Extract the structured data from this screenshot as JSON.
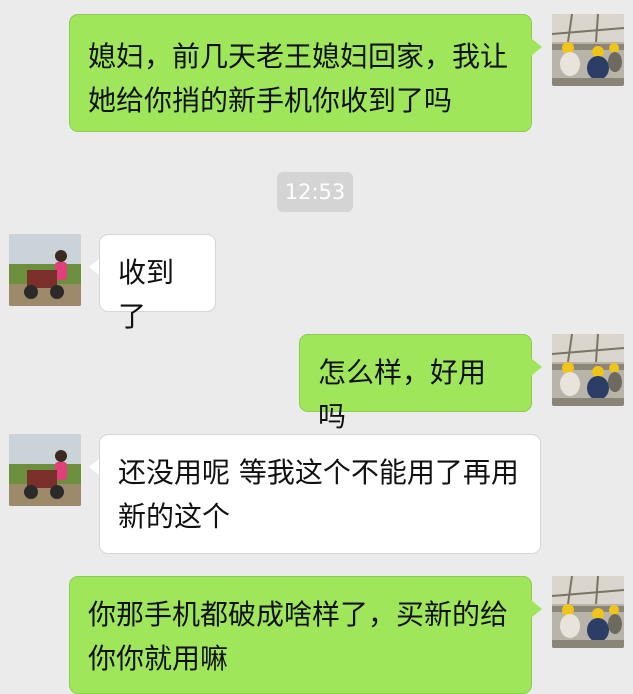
{
  "chat": {
    "timestamp": "12:53",
    "messages": [
      {
        "side": "out",
        "text": "媳妇，前几天老王媳妇回家，我让她给你捎的新手机你收到了吗",
        "avatar": "workers-avatar"
      },
      {
        "side": "in",
        "text": "收到了",
        "avatar": "woman-on-tricycle-avatar"
      },
      {
        "side": "out",
        "text": "怎么样，好用吗",
        "avatar": "workers-avatar"
      },
      {
        "side": "in",
        "text": "还没用呢 等我这个不能用了再用新的这个",
        "avatar": "woman-on-tricycle-avatar"
      },
      {
        "side": "out",
        "text": "你那手机都破成啥样了，买新的给你你就用嘛",
        "avatar": "workers-avatar"
      }
    ]
  },
  "colors": {
    "background": "#ebebeb",
    "outgoing_bubble": "#9fe65a",
    "incoming_bubble": "#ffffff",
    "timestamp_bg": "#d4d4d4"
  }
}
